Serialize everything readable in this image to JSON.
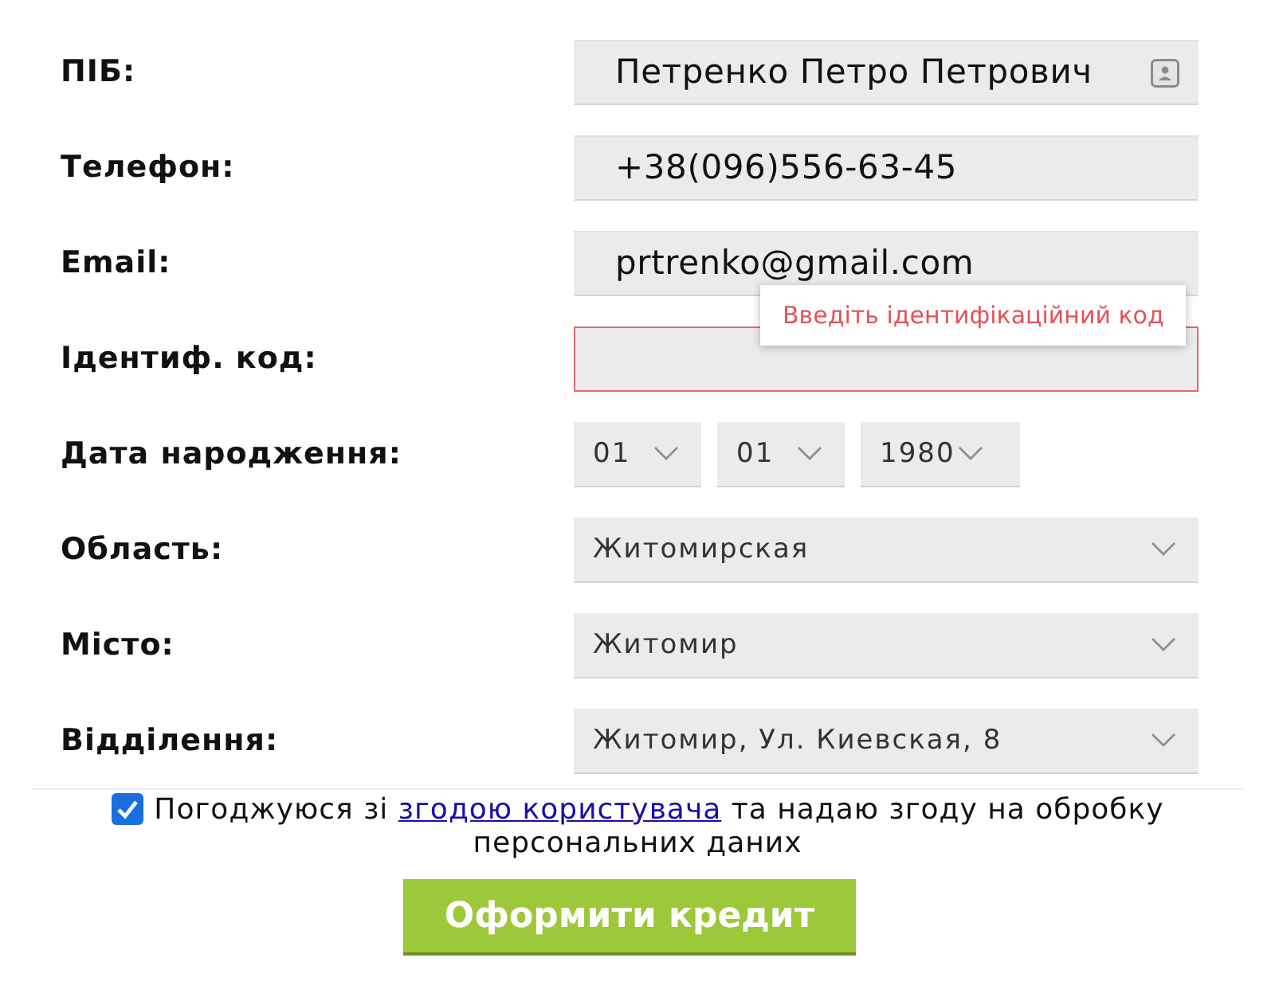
{
  "fields": [
    {
      "label": "ПІБ:",
      "kind": "input",
      "value": "Петренко Петро Петрович",
      "autofill": true,
      "invalid": false
    },
    {
      "label": "Телефон:",
      "kind": "input",
      "value": "+38(096)556-63-45",
      "invalid": false
    },
    {
      "label": "Email:",
      "kind": "input",
      "value": "prtrenko@gmail.com",
      "invalid": false
    },
    {
      "label": "Ідентиф. код:",
      "kind": "input",
      "invalid": true,
      "error": "Введіть ідентифікаційний код"
    },
    {
      "label": "Дата народження:",
      "kind": "date",
      "parts": [
        "01",
        "01",
        "1980"
      ]
    },
    {
      "label": "Область:",
      "kind": "select",
      "value": "Житомирская"
    },
    {
      "label": "Місто:",
      "kind": "select",
      "value": "Житомир"
    },
    {
      "label": "Відділення:",
      "kind": "select",
      "value": "Житомир, Ул. Киевская, 8"
    }
  ],
  "consent": {
    "checked": true,
    "text_before": "Погоджуюся зі",
    "link": "згодою користувача",
    "text_after": "та надаю згоду на обробку персональних даних"
  },
  "submit_button": "Оформити кредит"
}
